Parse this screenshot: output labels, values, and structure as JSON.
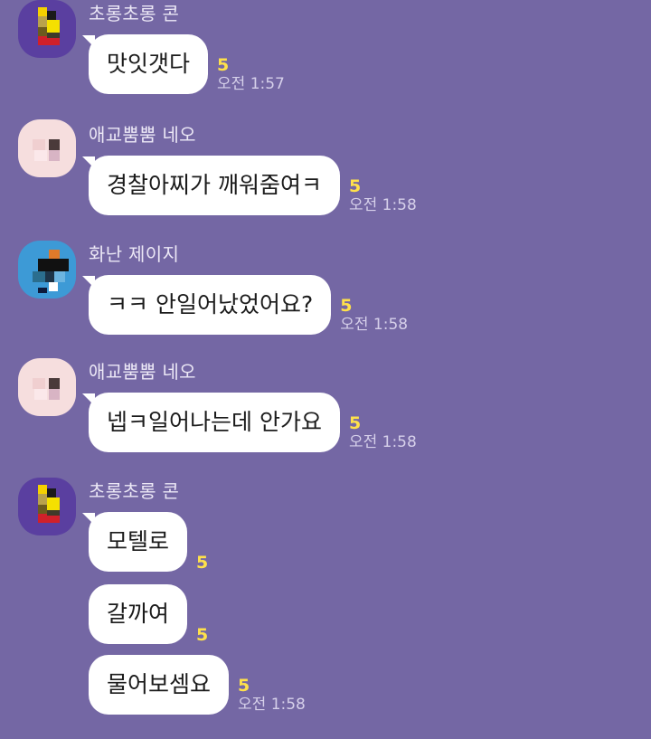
{
  "groups": [
    {
      "sender": "초롱초롱 콘",
      "avatar_icon": "yellow-pixel-avatar-icon",
      "messages": [
        {
          "text": "맛잇갯다",
          "unread": "5",
          "time": "오전 1:57"
        }
      ]
    },
    {
      "sender": "애교뿜뿜 네오",
      "avatar_icon": "pink-pixel-avatar-icon",
      "messages": [
        {
          "text": "경찰아찌가 깨워줌여ㅋ",
          "unread": "5",
          "time": "오전 1:58"
        }
      ]
    },
    {
      "sender": "화난 제이지",
      "avatar_icon": "blue-pixel-avatar-icon",
      "messages": [
        {
          "text": "ㅋㅋ 안일어났었어요?",
          "unread": "5",
          "time": "오전 1:58"
        }
      ]
    },
    {
      "sender": "애교뿜뿜 네오",
      "avatar_icon": "pink-pixel-avatar-icon",
      "messages": [
        {
          "text": "넵ㅋ일어나는데 안가요",
          "unread": "5",
          "time": "오전 1:58"
        }
      ]
    },
    {
      "sender": "초롱초롱 콘",
      "avatar_icon": "yellow-pixel-avatar-icon",
      "messages": [
        {
          "text": "모텔로",
          "unread": "5",
          "time": ""
        },
        {
          "text": "갈까여",
          "unread": "5",
          "time": ""
        },
        {
          "text": "물어보셈요",
          "unread": "5",
          "time": "오전 1:58"
        }
      ]
    }
  ],
  "colors": {
    "background": "#7467a4",
    "bubble": "#ffffff",
    "unread": "#ffe14a"
  }
}
